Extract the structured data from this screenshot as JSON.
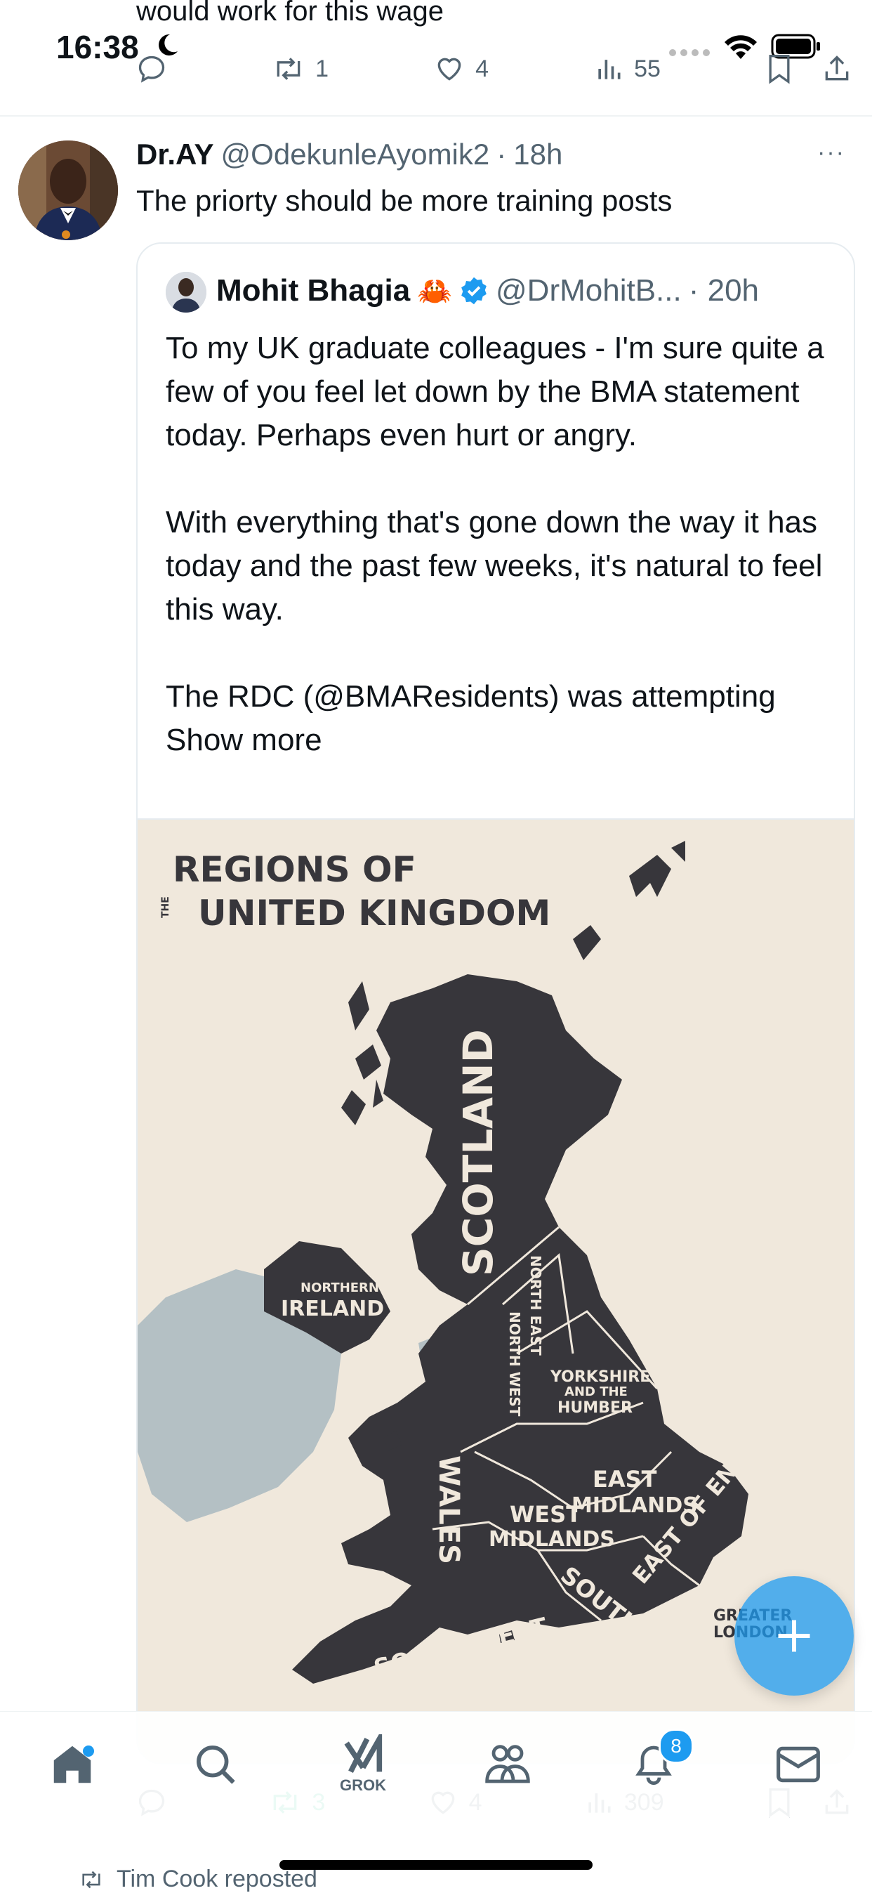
{
  "status_bar": {
    "time": "16:38"
  },
  "prev_tweet": {
    "text_tail": "would work for this wage",
    "retweets": "1",
    "likes": "4",
    "views": "55"
  },
  "tweet": {
    "name": "Dr.AY",
    "handle": "@OdekunleAyomik2",
    "sep": "·",
    "time": "18h",
    "text": "The priorty should be more training posts",
    "more": "···",
    "quote": {
      "name": "Mohit Bhagia",
      "emoji": "🦀",
      "handle": "@DrMohitB...",
      "time": "· 20h",
      "para1": "To my UK graduate colleagues - I'm sure quite a few of you feel let down by the BMA statement today. Perhaps even hurt or angry.",
      "para2": "With everything that's gone down the way it has today and the past few weeks, it's natural to feel this way.",
      "para3": "The RDC (@BMAResidents) was attempting",
      "show_more": "Show more",
      "map": {
        "title_line1": "REGIONS OF",
        "title_the": "THE",
        "title_line2": "UNITED KINGDOM",
        "regions": {
          "scotland": "SCOTLAND",
          "northern": "NORTHERN",
          "ireland": "IRELAND",
          "north_east": "NORTH EAST",
          "north_west": "NORTH WEST",
          "yorkshire1": "YORKSHIRE",
          "yorkshire2": "AND THE",
          "yorkshire3": "HUMBER",
          "wales": "WALES",
          "west1": "WEST",
          "west2": "MIDLANDS",
          "east1": "EAST",
          "east2": "MIDLANDS",
          "east_england": "EAST OF ENGLAND",
          "greater1": "GREATER",
          "greater2": "LONDON",
          "south_west": "SOUTH WEST",
          "south_east": "SOUTH EAST"
        }
      }
    },
    "retweets": "3",
    "likes": "4",
    "views": "309"
  },
  "tab_bar": {
    "grok_label": "GROK",
    "notif_count": "8"
  },
  "next_item": {
    "text": "Tim Cook reposted"
  },
  "colors": {
    "accent": "#1d9bf0",
    "retweet_green": "#00ba7c",
    "map_bg": "#f0e8dc",
    "land": "#37363b",
    "ireland": "#b4c0c4"
  }
}
